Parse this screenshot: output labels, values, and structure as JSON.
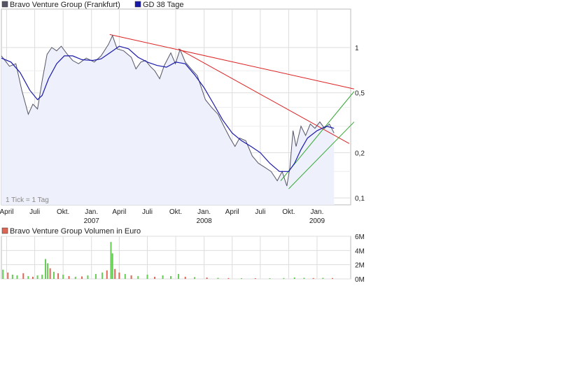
{
  "price_panel": {
    "legend_main": "Bravo Venture Group (Frankfurt)",
    "legend_ma": "GD 38 Tage",
    "tick_note": "1 Tick = 1 Tag"
  },
  "volume_panel": {
    "legend": "Bravo Venture Group Volumen in Euro"
  },
  "colors": {
    "price": "#555566",
    "ma": "#1a1aaa",
    "area_fill": "#eef0fb",
    "resistance": "#dd2222",
    "support": "#33aa33",
    "vol_up": "#66cc55",
    "vol_down": "#dd6655",
    "grid": "#dddddd"
  },
  "chart_data": [
    {
      "type": "line",
      "scale": "log",
      "y_ticks": [
        {
          "v": 1,
          "label": "1"
        },
        {
          "v": 0.5,
          "label": "0,5"
        },
        {
          "v": 0.2,
          "label": "0,2"
        },
        {
          "v": 0.1,
          "label": "0,1"
        }
      ],
      "ylim": [
        0.09,
        1.8
      ],
      "x_months": [
        "2006-04",
        "2006-07",
        "2006-10",
        "2007-01",
        "2007-04",
        "2007-07",
        "2007-10",
        "2008-01",
        "2008-04",
        "2008-07",
        "2008-10",
        "2009-01"
      ],
      "x_month_labels": [
        "April",
        "Juli",
        "Okt.",
        "Jan.",
        "April",
        "Juli",
        "Okt.",
        "Jan.",
        "April",
        "Juli",
        "Okt.",
        "Jan."
      ],
      "x_year_labels": [
        {
          "at": "2007-01",
          "label": "2007"
        },
        {
          "at": "2008-01",
          "label": "2008"
        },
        {
          "at": "2009-01",
          "label": "2009"
        }
      ],
      "xlim": [
        "2006-03-15",
        "2009-04-20"
      ],
      "series": [
        {
          "name": "Bravo Venture Group (Frankfurt)",
          "points": [
            [
              "2006-03-15",
              0.88
            ],
            [
              "2006-04-10",
              0.75
            ],
            [
              "2006-05-01",
              0.78
            ],
            [
              "2006-05-20",
              0.52
            ],
            [
              "2006-06-10",
              0.36
            ],
            [
              "2006-06-25",
              0.42
            ],
            [
              "2006-07-10",
              0.39
            ],
            [
              "2006-07-25",
              0.6
            ],
            [
              "2006-08-10",
              0.9
            ],
            [
              "2006-08-25",
              1.0
            ],
            [
              "2006-09-10",
              0.95
            ],
            [
              "2006-09-25",
              1.02
            ],
            [
              "2006-10-15",
              0.9
            ],
            [
              "2006-11-01",
              0.82
            ],
            [
              "2006-11-20",
              0.78
            ],
            [
              "2006-12-15",
              0.85
            ],
            [
              "2007-01-10",
              0.8
            ],
            [
              "2007-02-01",
              0.88
            ],
            [
              "2007-02-25",
              1.05
            ],
            [
              "2007-03-10",
              1.2
            ],
            [
              "2007-03-25",
              0.98
            ],
            [
              "2007-04-15",
              0.95
            ],
            [
              "2007-05-10",
              0.86
            ],
            [
              "2007-05-25",
              0.72
            ],
            [
              "2007-06-10",
              0.8
            ],
            [
              "2007-06-25",
              0.82
            ],
            [
              "2007-07-10",
              0.75
            ],
            [
              "2007-07-25",
              0.7
            ],
            [
              "2007-08-10",
              0.62
            ],
            [
              "2007-08-25",
              0.76
            ],
            [
              "2007-09-15",
              0.92
            ],
            [
              "2007-09-30",
              0.78
            ],
            [
              "2007-10-15",
              0.97
            ],
            [
              "2007-11-01",
              0.8
            ],
            [
              "2007-11-20",
              0.72
            ],
            [
              "2007-12-10",
              0.65
            ],
            [
              "2008-01-05",
              0.45
            ],
            [
              "2008-01-25",
              0.4
            ],
            [
              "2008-02-15",
              0.36
            ],
            [
              "2008-03-05",
              0.3
            ],
            [
              "2008-03-25",
              0.25
            ],
            [
              "2008-04-10",
              0.22
            ],
            [
              "2008-04-25",
              0.25
            ],
            [
              "2008-05-15",
              0.24
            ],
            [
              "2008-06-05",
              0.19
            ],
            [
              "2008-06-25",
              0.17
            ],
            [
              "2008-07-15",
              0.16
            ],
            [
              "2008-08-05",
              0.15
            ],
            [
              "2008-08-25",
              0.13
            ],
            [
              "2008-09-10",
              0.15
            ],
            [
              "2008-09-25",
              0.12
            ],
            [
              "2008-10-05",
              0.16
            ],
            [
              "2008-10-15",
              0.28
            ],
            [
              "2008-10-25",
              0.22
            ],
            [
              "2008-11-10",
              0.3
            ],
            [
              "2008-11-25",
              0.26
            ],
            [
              "2008-12-10",
              0.31
            ],
            [
              "2008-12-25",
              0.29
            ],
            [
              "2009-01-10",
              0.32
            ],
            [
              "2009-01-25",
              0.29
            ],
            [
              "2009-02-10",
              0.31
            ],
            [
              "2009-02-25",
              0.27
            ]
          ]
        },
        {
          "name": "GD 38 Tage",
          "points": [
            [
              "2006-03-15",
              0.85
            ],
            [
              "2006-04-15",
              0.8
            ],
            [
              "2006-05-15",
              0.68
            ],
            [
              "2006-06-15",
              0.52
            ],
            [
              "2006-07-10",
              0.45
            ],
            [
              "2006-07-25",
              0.48
            ],
            [
              "2006-08-15",
              0.62
            ],
            [
              "2006-09-10",
              0.78
            ],
            [
              "2006-10-05",
              0.88
            ],
            [
              "2006-11-01",
              0.88
            ],
            [
              "2006-12-01",
              0.83
            ],
            [
              "2007-01-05",
              0.82
            ],
            [
              "2007-02-01",
              0.84
            ],
            [
              "2007-03-01",
              0.92
            ],
            [
              "2007-04-01",
              1.02
            ],
            [
              "2007-05-01",
              0.98
            ],
            [
              "2007-06-01",
              0.86
            ],
            [
              "2007-07-01",
              0.8
            ],
            [
              "2007-08-01",
              0.76
            ],
            [
              "2007-09-01",
              0.74
            ],
            [
              "2007-10-01",
              0.8
            ],
            [
              "2007-11-01",
              0.78
            ],
            [
              "2007-12-01",
              0.66
            ],
            [
              "2008-01-01",
              0.54
            ],
            [
              "2008-02-01",
              0.42
            ],
            [
              "2008-03-01",
              0.33
            ],
            [
              "2008-04-01",
              0.27
            ],
            [
              "2008-05-01",
              0.24
            ],
            [
              "2008-06-01",
              0.22
            ],
            [
              "2008-07-01",
              0.2
            ],
            [
              "2008-08-01",
              0.17
            ],
            [
              "2008-09-01",
              0.15
            ],
            [
              "2008-10-01",
              0.15
            ],
            [
              "2008-10-20",
              0.17
            ],
            [
              "2008-11-10",
              0.21
            ],
            [
              "2008-12-01",
              0.25
            ],
            [
              "2009-01-01",
              0.28
            ],
            [
              "2009-02-01",
              0.3
            ],
            [
              "2009-02-25",
              0.29
            ]
          ]
        }
      ],
      "trendlines": [
        {
          "kind": "resistance",
          "from": [
            "2007-03-01",
            1.22
          ],
          "to": [
            "2009-05-01",
            0.53
          ]
        },
        {
          "kind": "resistance",
          "from": [
            "2007-10-10",
            0.98
          ],
          "to": [
            "2009-04-15",
            0.23
          ]
        },
        {
          "kind": "support",
          "from": [
            "2008-09-05",
            0.13
          ],
          "to": [
            "2009-05-01",
            0.51
          ]
        },
        {
          "kind": "support",
          "from": [
            "2008-10-01",
            0.115
          ],
          "to": [
            "2009-05-01",
            0.32
          ]
        }
      ]
    },
    {
      "type": "bar",
      "y_ticks": [
        {
          "v": 6000000,
          "label": "6M"
        },
        {
          "v": 4000000,
          "label": "4M"
        },
        {
          "v": 2000000,
          "label": "2M"
        },
        {
          "v": 0,
          "label": "0M"
        }
      ],
      "ylim": [
        0,
        6000000
      ],
      "series": [
        {
          "name": "Bravo Venture Group Volumen in Euro",
          "bars": [
            [
              "2006-03-20",
              1300000,
              "up"
            ],
            [
              "2006-04-05",
              900000,
              "down"
            ],
            [
              "2006-04-20",
              600000,
              "up"
            ],
            [
              "2006-05-05",
              500000,
              "up"
            ],
            [
              "2006-05-25",
              800000,
              "down"
            ],
            [
              "2006-06-10",
              400000,
              "up"
            ],
            [
              "2006-06-25",
              300000,
              "down"
            ],
            [
              "2006-07-10",
              500000,
              "up"
            ],
            [
              "2006-07-25",
              600000,
              "up"
            ],
            [
              "2006-08-05",
              2800000,
              "up"
            ],
            [
              "2006-08-12",
              2200000,
              "up"
            ],
            [
              "2006-08-20",
              1500000,
              "down"
            ],
            [
              "2006-09-01",
              1000000,
              "up"
            ],
            [
              "2006-09-15",
              800000,
              "down"
            ],
            [
              "2006-10-01",
              600000,
              "up"
            ],
            [
              "2006-10-20",
              400000,
              "down"
            ],
            [
              "2006-11-10",
              300000,
              "up"
            ],
            [
              "2006-12-01",
              350000,
              "down"
            ],
            [
              "2006-12-20",
              500000,
              "up"
            ],
            [
              "2007-01-15",
              700000,
              "up"
            ],
            [
              "2007-02-05",
              900000,
              "up"
            ],
            [
              "2007-02-20",
              1200000,
              "down"
            ],
            [
              "2007-03-05",
              5200000,
              "up"
            ],
            [
              "2007-03-10",
              3600000,
              "up"
            ],
            [
              "2007-03-18",
              1400000,
              "down"
            ],
            [
              "2007-04-01",
              900000,
              "down"
            ],
            [
              "2007-04-20",
              700000,
              "up"
            ],
            [
              "2007-05-10",
              500000,
              "down"
            ],
            [
              "2007-06-01",
              400000,
              "up"
            ],
            [
              "2007-07-01",
              600000,
              "up"
            ],
            [
              "2007-07-25",
              300000,
              "down"
            ],
            [
              "2007-08-20",
              500000,
              "up"
            ],
            [
              "2007-09-15",
              400000,
              "up"
            ],
            [
              "2007-10-10",
              700000,
              "up"
            ],
            [
              "2007-11-01",
              300000,
              "down"
            ],
            [
              "2007-12-01",
              250000,
              "up"
            ],
            [
              "2008-01-10",
              200000,
              "down"
            ],
            [
              "2008-02-15",
              150000,
              "up"
            ],
            [
              "2008-03-20",
              120000,
              "down"
            ],
            [
              "2008-05-01",
              100000,
              "up"
            ],
            [
              "2008-06-15",
              100000,
              "down"
            ],
            [
              "2008-08-01",
              90000,
              "up"
            ],
            [
              "2008-09-15",
              120000,
              "up"
            ],
            [
              "2008-10-20",
              200000,
              "up"
            ],
            [
              "2008-11-20",
              150000,
              "up"
            ],
            [
              "2008-12-20",
              120000,
              "down"
            ],
            [
              "2009-01-20",
              150000,
              "up"
            ],
            [
              "2009-02-20",
              120000,
              "down"
            ]
          ]
        }
      ]
    }
  ]
}
